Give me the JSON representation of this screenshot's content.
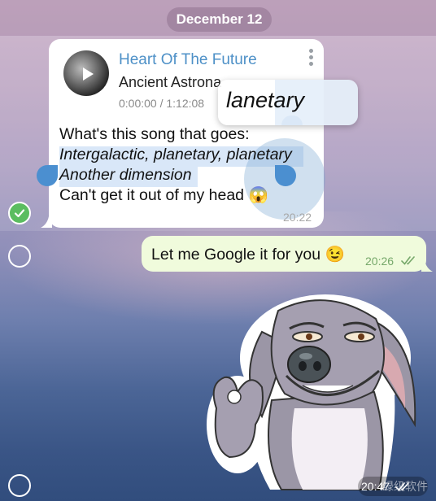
{
  "date_chip": "December 12",
  "audio": {
    "title": "Heart Of The Future",
    "artist": "Ancient Astrona",
    "time": "0:00:00 / 1:12:08"
  },
  "incoming": {
    "lines": [
      "What's this song that goes:",
      "Intergalactic, planetary, planetary",
      "Another dimension",
      "Can't get it out of my head 😱"
    ],
    "time": "20:22"
  },
  "magnifier_text": "lanetary",
  "outgoing": {
    "text": "Let me Google it for you 😉",
    "time": "20:26"
  },
  "sticker": {
    "time": "20:47"
  },
  "watermark": "绿级软件",
  "colors": {
    "accent": "#4d90c7",
    "check": "#5bbd60",
    "outgoing_bubble": "#f0fbdc",
    "outgoing_time": "#76a86a"
  }
}
